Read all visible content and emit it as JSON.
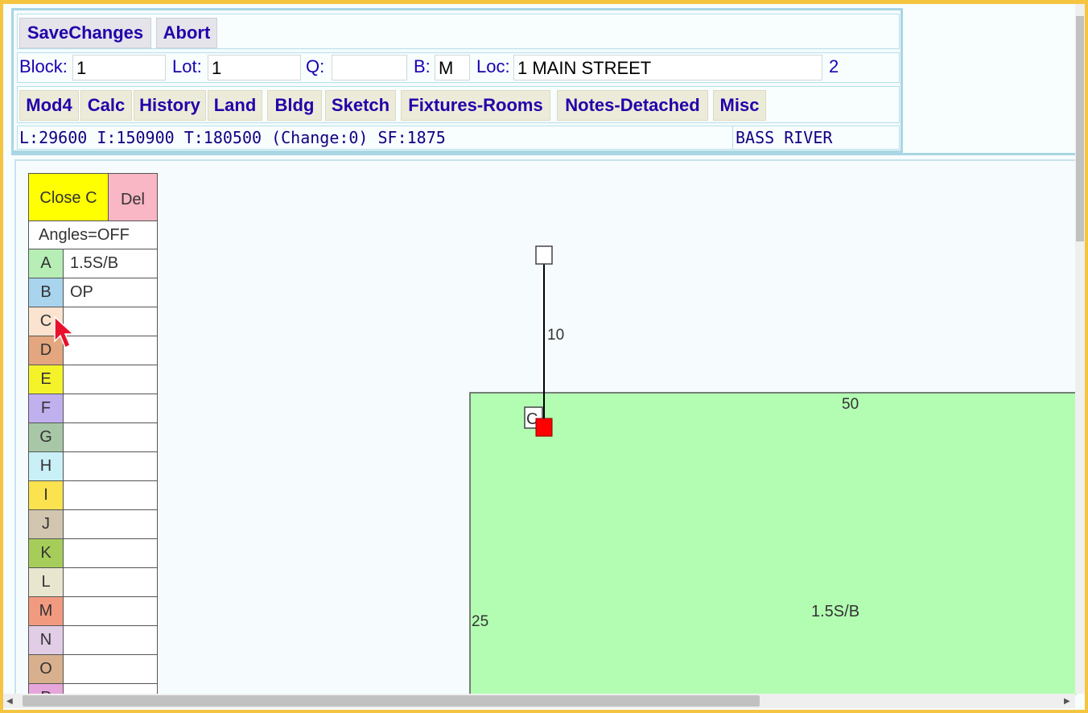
{
  "toolbar": {
    "save_label": "SaveChanges",
    "abort_label": "Abort"
  },
  "fields": {
    "block_label": "Block:",
    "block_value": "1",
    "lot_label": "Lot:",
    "lot_value": "1",
    "q_label": "Q:",
    "q_value": "",
    "b_label": "B:",
    "b_value": "M",
    "loc_label": "Loc:",
    "loc_value": "1 MAIN STREET",
    "card_number": "2"
  },
  "nav": {
    "mod4": "Mod4",
    "calc": "Calc",
    "history": "History",
    "land": "Land",
    "bldg": "Bldg",
    "sketch": "Sketch",
    "fixtures": "Fixtures-Rooms",
    "notes": "Notes-Detached",
    "misc": "Misc"
  },
  "info": {
    "summary": "L:29600 I:150900 T:180500 (Change:0) SF:1875",
    "area": "BASS RIVER"
  },
  "sketch_panel": {
    "close_label": "Close C",
    "del_label": "Del",
    "angles_label": "Angles=OFF",
    "areas": [
      {
        "letter": "A",
        "desc": "1.5S/B",
        "color": "#b6eeb6"
      },
      {
        "letter": "B",
        "desc": "OP",
        "color": "#a8d4ee"
      },
      {
        "letter": "C",
        "desc": "",
        "color": "#fbe3cf"
      },
      {
        "letter": "D",
        "desc": "",
        "color": "#e3a67f"
      },
      {
        "letter": "E",
        "desc": "",
        "color": "#f4f32a"
      },
      {
        "letter": "F",
        "desc": "",
        "color": "#c1b0ee"
      },
      {
        "letter": "G",
        "desc": "",
        "color": "#a7c7a7"
      },
      {
        "letter": "H",
        "desc": "",
        "color": "#c9f0f7"
      },
      {
        "letter": "I",
        "desc": "",
        "color": "#fbe24f"
      },
      {
        "letter": "J",
        "desc": "",
        "color": "#d2c6b0"
      },
      {
        "letter": "K",
        "desc": "",
        "color": "#a6cd5a"
      },
      {
        "letter": "L",
        "desc": "",
        "color": "#e9e6d0"
      },
      {
        "letter": "M",
        "desc": "",
        "color": "#f29a80"
      },
      {
        "letter": "N",
        "desc": "",
        "color": "#e1cde6"
      },
      {
        "letter": "O",
        "desc": "",
        "color": "#d8b08e"
      },
      {
        "letter": "P",
        "desc": "",
        "color": "#e6a6dc"
      }
    ]
  },
  "drawing": {
    "dim_top": "50",
    "dim_left": "25",
    "dim_line": "10",
    "area_label": "1.5S/B",
    "node_label": "C",
    "area_fill": "#b3fdb3",
    "active_node_color": "#ff0000"
  }
}
